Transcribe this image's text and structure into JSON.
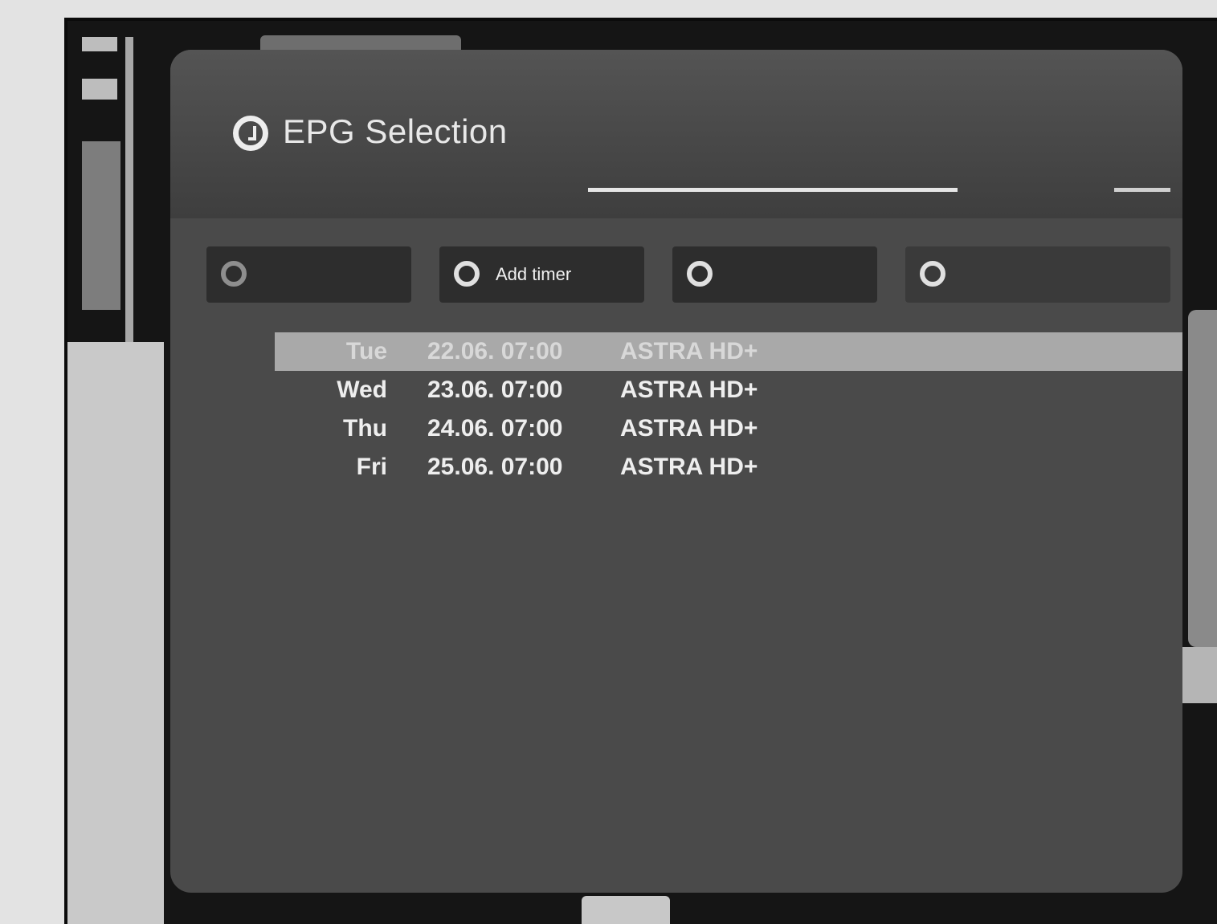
{
  "dialog": {
    "title": "EPG Selection",
    "buttons": [
      {
        "label": ""
      },
      {
        "label": "Add timer"
      },
      {
        "label": ""
      },
      {
        "label": ""
      }
    ],
    "entries": [
      {
        "day": "Tue",
        "datetime": "22.06. 07:00",
        "channel": "ASTRA HD+"
      },
      {
        "day": "Wed",
        "datetime": "23.06. 07:00",
        "channel": "ASTRA HD+"
      },
      {
        "day": "Thu",
        "datetime": "24.06. 07:00",
        "channel": "ASTRA HD+"
      },
      {
        "day": "Fri",
        "datetime": "25.06. 07:00",
        "channel": "ASTRA HD+"
      }
    ],
    "selected_index": 0
  }
}
